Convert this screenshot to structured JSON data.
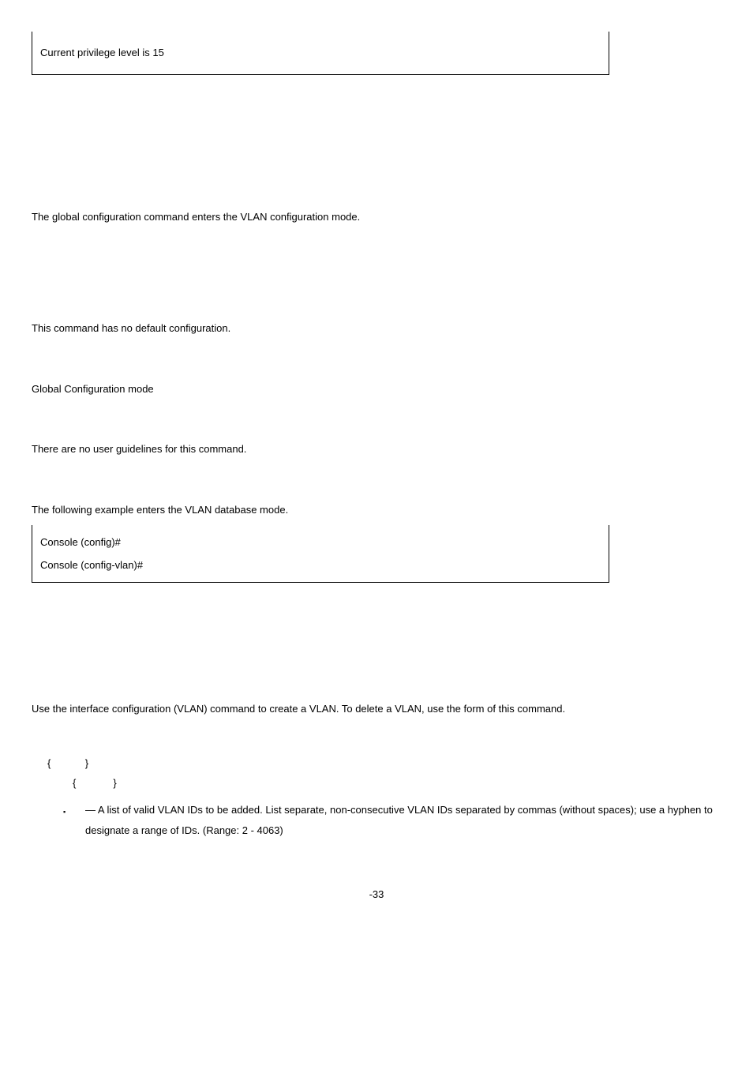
{
  "box1": {
    "line1": "Current privilege level is 15"
  },
  "para1": {
    "pre": "The ",
    "post": " global configuration command enters the VLAN configuration mode."
  },
  "para2": "This command has no default configuration.",
  "para3": "Global Configuration mode",
  "para4": "There are no user guidelines for this command.",
  "para5": "The following example enters the VLAN database mode.",
  "box2": {
    "line1": "Console (config)# ",
    "line2": "Console (config-vlan)#"
  },
  "para6": {
    "pre": "Use the ",
    "mid": " interface configuration (VLAN) command to create a VLAN. To delete a VLAN, use the ",
    "post": " form of this command."
  },
  "syntax": {
    "l1a": " {",
    "l1b": "}",
    "l2a": " {",
    "l2b": "}"
  },
  "bullet1": {
    "text": " — A list of valid VLAN IDs to be added. List separate, non-consecutive VLAN IDs separated by commas (without spaces); use a hyphen to designate a range of IDs. (Range: 2 - 4063)"
  },
  "pagenum": "-33"
}
